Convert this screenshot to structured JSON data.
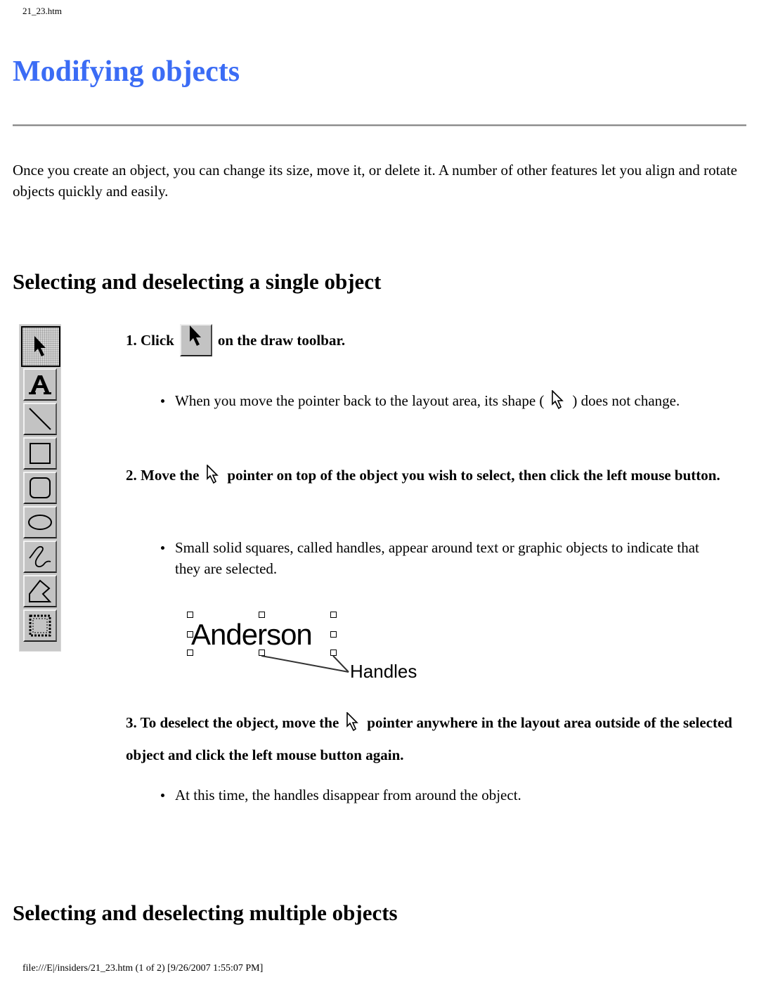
{
  "header": {
    "filename": "21_23.htm"
  },
  "title": "Modifying objects",
  "intro": "Once you create an object, you can change its size, move it, or delete it. A number of other features let you align and rotate objects quickly and easily.",
  "section1": {
    "heading": "Selecting and deselecting a single object",
    "toolbar": {
      "tools": [
        {
          "name": "pointer-tool",
          "icon": "arrow-pointer-icon",
          "active": true
        },
        {
          "name": "text-tool",
          "icon": "text-a-icon"
        },
        {
          "name": "line-tool",
          "icon": "line-icon"
        },
        {
          "name": "rectangle-tool",
          "icon": "rectangle-icon"
        },
        {
          "name": "rounded-rectangle-tool",
          "icon": "rounded-rectangle-icon"
        },
        {
          "name": "ellipse-tool",
          "icon": "ellipse-icon"
        },
        {
          "name": "freeform-tool",
          "icon": "freeform-curve-icon"
        },
        {
          "name": "polygon-tool",
          "icon": "polygon-icon"
        },
        {
          "name": "frame-tool",
          "icon": "dotted-frame-icon"
        }
      ]
    },
    "step1": {
      "before": "1. Click",
      "after": "on the draw toolbar."
    },
    "bullet1": {
      "before": "When you move the pointer back to the layout area, its shape (",
      "after": ") does not change."
    },
    "step2": {
      "before": "2. Move the",
      "after": "pointer on top of the object you wish to select, then click the left mouse button."
    },
    "bullet2": "Small solid squares, called handles, appear around text or graphic objects to indicate that they are selected.",
    "figure": {
      "word": "Anderson",
      "label": "Handles"
    },
    "step3": {
      "before": "3. To deselect the object, move the",
      "after": "pointer anywhere in the layout area outside of the selected object and click the left mouse button again."
    },
    "bullet3": "At this time, the handles disappear from around the object."
  },
  "section2": {
    "heading": "Selecting and deselecting multiple objects"
  },
  "footer": {
    "path": "file:///E|/insiders/21_23.htm (1 of 2) [9/26/2007 1:55:07 PM]"
  }
}
